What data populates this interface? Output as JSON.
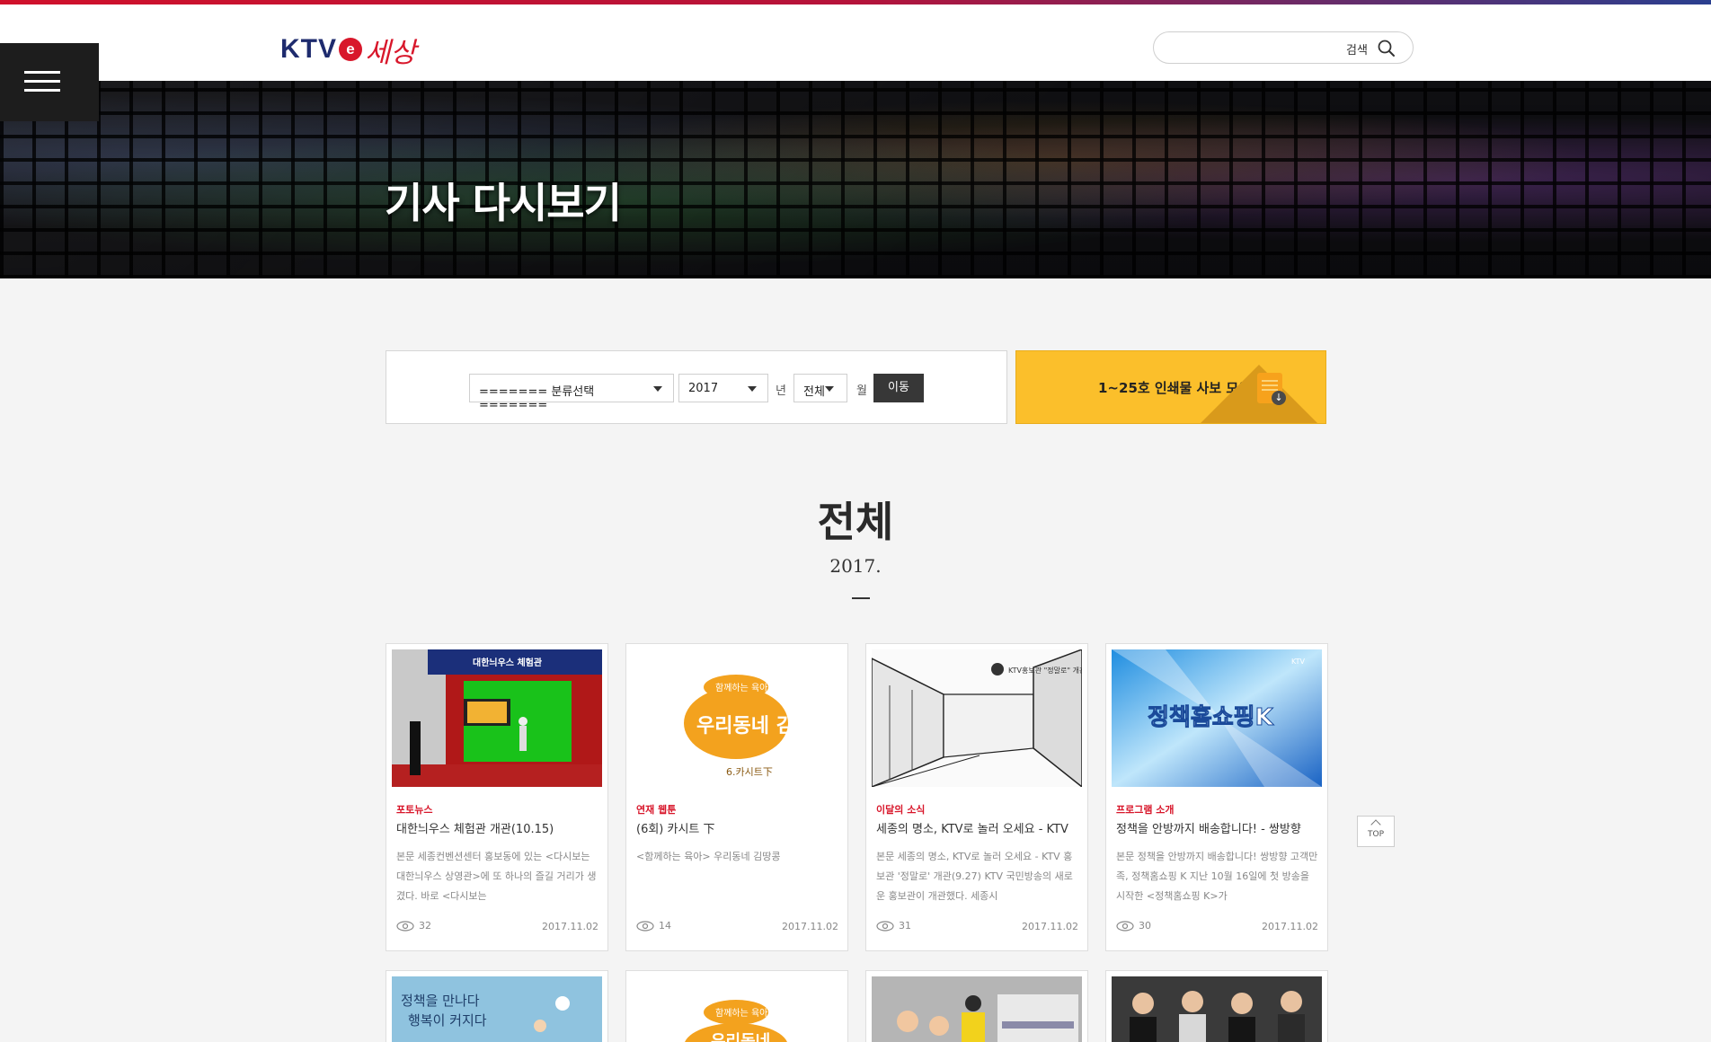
{
  "brand": {
    "logo_ktv": "KTV",
    "logo_e": "e",
    "logo_sesang": "세상",
    "colors": {
      "red": "#d8172b",
      "navy": "#1e2b6e",
      "yellow": "#fbbf2b"
    }
  },
  "header": {
    "menu_icon": "hamburger-icon",
    "search": {
      "placeholder": "",
      "button_label": "검색",
      "icon": "search-icon"
    }
  },
  "hero": {
    "title": "기사 다시보기"
  },
  "filter": {
    "category": {
      "selected": "======= 분류선택 ======="
    },
    "year": {
      "selected": "2017",
      "unit": "년"
    },
    "month": {
      "selected": "전체",
      "unit": "월"
    },
    "go_label": "이동",
    "archive_label": "1~25호 인쇄물 사보 모음",
    "archive_icon": "pdf-download-icon"
  },
  "section": {
    "title": "전체",
    "date": "2017."
  },
  "cards": [
    {
      "category": "포토뉴스",
      "title": "대한늬우스 체험관 개관(10.15)",
      "description": "본문 세종컨벤션센터 홍보동에 있는 <다시보는 대한늬우스 상영관>에 또 하나의 즐길 거리가 생겼다. 바로 <다시보는",
      "views": "32",
      "date": "2017.11.02"
    },
    {
      "category": "연재 웹툰",
      "title": "(6회) 카시트 下",
      "description": "<함께하는 육아> 우리동네 김땅콩",
      "views": "14",
      "date": "2017.11.02"
    },
    {
      "category": "이달의 소식",
      "title": "세종의 명소, KTV로 놀러 오세요 - KTV",
      "description": "본문 세종의 명소, KTV로 놀러 오세요 - KTV 홍보관 '정말로' 개관(9.27) KTV 국민방송의 새로운 홍보관이 개관했다. 세종시",
      "views": "31",
      "date": "2017.11.02"
    },
    {
      "category": "프로그램 소개",
      "title": "정책을 안방까지 배송합니다! - 쌍방향",
      "description": "본문 정책을 안방까지 배송합니다! 쌍방향 고객만족, 정책홈쇼핑 K 지난 10월 16일에 첫 방송을 시작한 <정책홈쇼핑 K>가",
      "views": "30",
      "date": "2017.11.02"
    }
  ],
  "thumb_texts": {
    "card1_banner": "대한늬우스 체험관",
    "card2_tag": "함께하는 육아",
    "card2_title": "우리동네 김땅콩",
    "card2_sub": "6.카시트下",
    "card3_sign": "KTV홍보관 \"정말로\" 개관",
    "card4_title": "정책홈쇼핑K",
    "card4_corner": "KTV",
    "row2_card1_text_1": "정책을 만나다",
    "row2_card1_text_2": "행복이 커지다",
    "row2_card2_tag": "함께하는 육아",
    "row2_card2_title": "우리동네"
  },
  "top_button": {
    "label": "TOP"
  }
}
